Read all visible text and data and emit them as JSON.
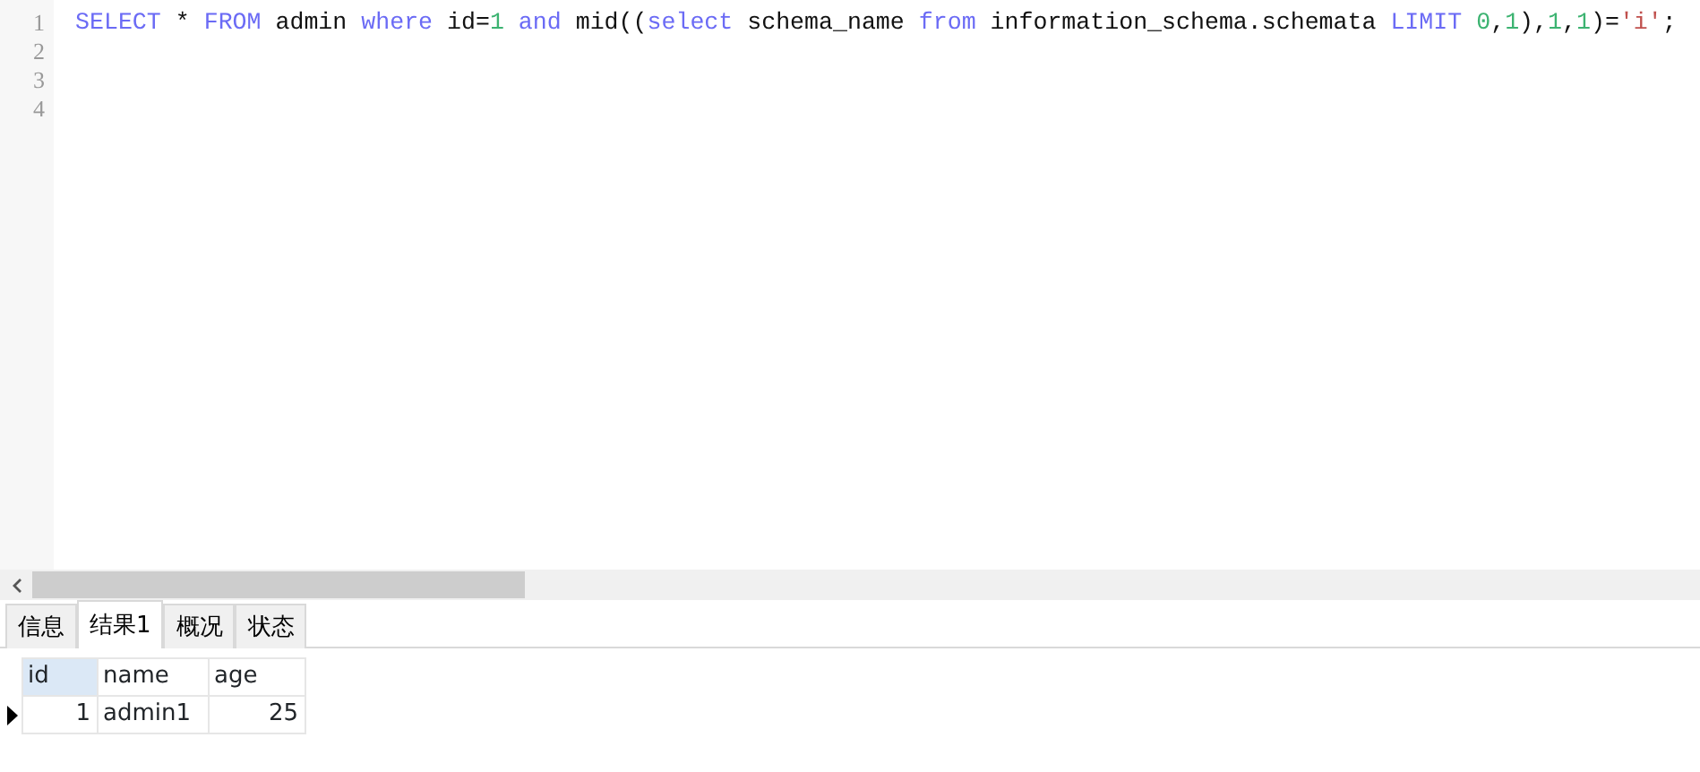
{
  "editor": {
    "lines": [
      {
        "number": "1",
        "tokens": [
          {
            "kind": "keyword",
            "text": "SELECT"
          },
          {
            "kind": "plain",
            "text": " * "
          },
          {
            "kind": "keyword",
            "text": "FROM"
          },
          {
            "kind": "plain",
            "text": " admin "
          },
          {
            "kind": "keyword",
            "text": "where"
          },
          {
            "kind": "plain",
            "text": " id="
          },
          {
            "kind": "number",
            "text": "1"
          },
          {
            "kind": "keyword",
            "text": " and"
          },
          {
            "kind": "plain",
            "text": " mid(("
          },
          {
            "kind": "keyword",
            "text": "select"
          },
          {
            "kind": "plain",
            "text": " schema_name "
          },
          {
            "kind": "keyword",
            "text": "from"
          },
          {
            "kind": "plain",
            "text": " information_schema.schemata "
          },
          {
            "kind": "keyword",
            "text": "LIMIT"
          },
          {
            "kind": "number",
            "text": " 0"
          },
          {
            "kind": "plain",
            "text": ","
          },
          {
            "kind": "number",
            "text": "1"
          },
          {
            "kind": "plain",
            "text": "),"
          },
          {
            "kind": "number",
            "text": "1"
          },
          {
            "kind": "plain",
            "text": ","
          },
          {
            "kind": "number",
            "text": "1"
          },
          {
            "kind": "plain",
            "text": ")="
          },
          {
            "kind": "string",
            "text": "'i'"
          },
          {
            "kind": "plain",
            "text": ";"
          }
        ]
      },
      {
        "number": "2"
      },
      {
        "number": "3"
      },
      {
        "number": "4"
      }
    ]
  },
  "tabs": [
    {
      "label": "信息",
      "selected": false
    },
    {
      "label": "结果1",
      "selected": true
    },
    {
      "label": "概况",
      "selected": false
    },
    {
      "label": "状态",
      "selected": false
    }
  ],
  "table": {
    "columns": [
      {
        "label": "id",
        "selected": true
      },
      {
        "label": "name",
        "selected": false
      },
      {
        "label": "age",
        "selected": false
      }
    ],
    "rows": [
      {
        "current": true,
        "cells": [
          "1",
          "admin1",
          "25"
        ]
      }
    ]
  }
}
